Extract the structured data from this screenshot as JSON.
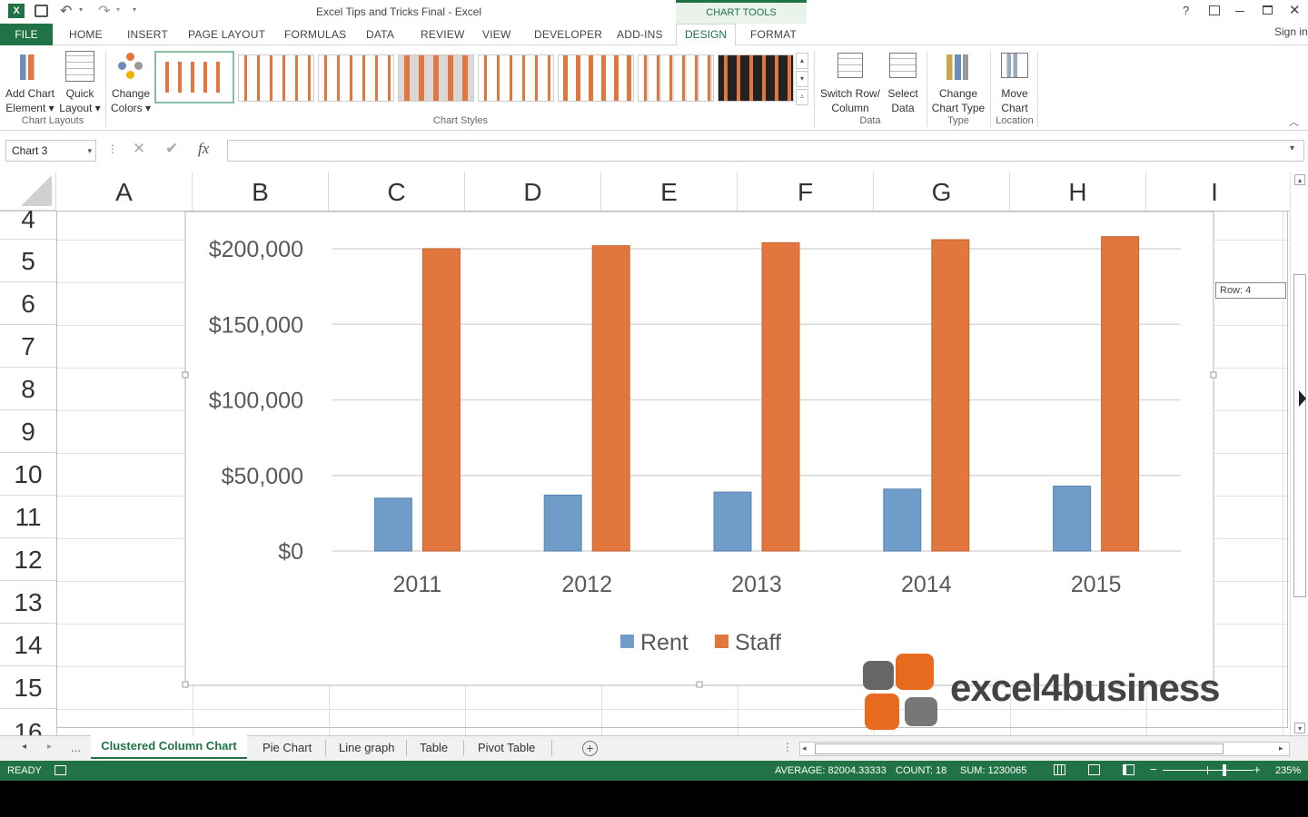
{
  "window": {
    "title": "Excel Tips and Tricks Final - Excel",
    "context_group": "CHART TOOLS",
    "sign_in": "Sign in",
    "help": "?"
  },
  "ribbon_tabs": [
    "FILE",
    "HOME",
    "INSERT",
    "PAGE LAYOUT",
    "FORMULAS",
    "DATA",
    "REVIEW",
    "VIEW",
    "DEVELOPER",
    "ADD-INS",
    "DESIGN",
    "FORMAT"
  ],
  "ribbon": {
    "add_chart_element": [
      "Add Chart",
      "Element ▾"
    ],
    "quick_layout": [
      "Quick",
      "Layout ▾"
    ],
    "change_colors": [
      "Change",
      "Colors ▾"
    ],
    "switch_row_col": [
      "Switch Row/",
      "Column"
    ],
    "select_data": [
      "Select",
      "Data"
    ],
    "change_chart_type": [
      "Change",
      "Chart Type"
    ],
    "move_chart": [
      "Move",
      "Chart"
    ],
    "groups": {
      "chart_layouts": "Chart Layouts",
      "chart_styles": "Chart Styles",
      "data": "Data",
      "type": "Type",
      "location": "Location"
    }
  },
  "formula_bar": {
    "name_box": "Chart 3",
    "fx": "fx",
    "value": ""
  },
  "columns": [
    "A",
    "B",
    "C",
    "D",
    "E",
    "F",
    "G",
    "H",
    "I"
  ],
  "rows": [
    "4",
    "5",
    "6",
    "7",
    "8",
    "9",
    "10",
    "11",
    "12",
    "13",
    "14",
    "15",
    "16"
  ],
  "tooltip": "Row: 4",
  "chart_data": {
    "type": "bar",
    "categories": [
      "2011",
      "2012",
      "2013",
      "2014",
      "2015"
    ],
    "series": [
      {
        "name": "Rent",
        "values": [
          35000,
          37000,
          39000,
          41000,
          43000
        ],
        "color": "#6f9cc9"
      },
      {
        "name": "Staff",
        "values": [
          200000,
          202000,
          204000,
          206000,
          208000
        ],
        "color": "#e1773f"
      }
    ],
    "yticks": [
      "$0",
      "$50,000",
      "$100,000",
      "$150,000",
      "$200,000"
    ],
    "ylim": [
      0,
      200000
    ],
    "legend": "bottom"
  },
  "watermark": {
    "text": "excel4business"
  },
  "sheet_tabs": [
    "Clustered Column Chart",
    "Pie Chart",
    "Line graph",
    "Table",
    "Pivot Table"
  ],
  "sheet_ellipsis": "...",
  "status": {
    "ready": "READY",
    "average": "AVERAGE: 82004.33333",
    "count": "COUNT: 18",
    "sum": "SUM: 1230065",
    "zoom": "235%"
  },
  "colors": {
    "excel_green": "#217346",
    "accent_orange": "#e1773f",
    "accent_blue": "#6f9cc9"
  }
}
